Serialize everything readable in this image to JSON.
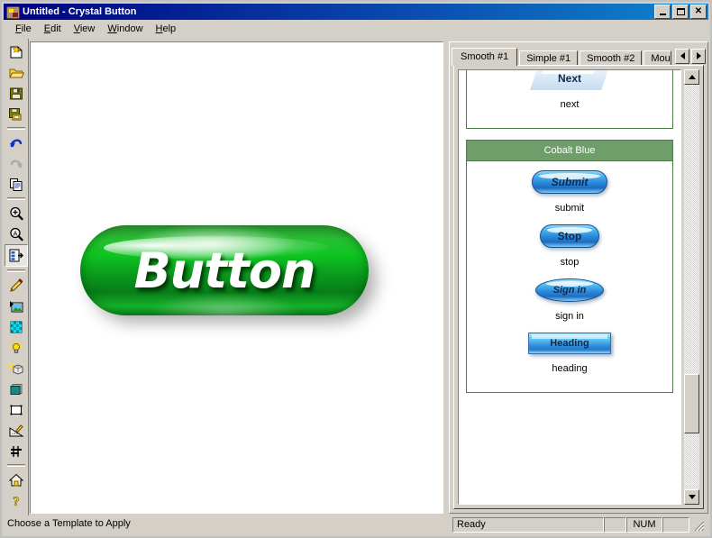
{
  "window": {
    "title": "Untitled - Crystal Button",
    "icon": "app-icon",
    "controls": {
      "minimize": "minimize",
      "maximize": "maximize",
      "close": "close"
    }
  },
  "menu": {
    "items": [
      {
        "label": "File",
        "accel": "F"
      },
      {
        "label": "Edit",
        "accel": "E"
      },
      {
        "label": "View",
        "accel": "V"
      },
      {
        "label": "Window",
        "accel": "W"
      },
      {
        "label": "Help",
        "accel": "H"
      }
    ]
  },
  "toolbar": {
    "tools": [
      {
        "name": "new-icon",
        "title": "New"
      },
      {
        "name": "open-folder-icon",
        "title": "Open"
      },
      {
        "name": "save-icon",
        "title": "Save"
      },
      {
        "name": "save-all-icon",
        "title": "Save All"
      },
      {
        "sep": true
      },
      {
        "name": "undo-icon",
        "title": "Undo"
      },
      {
        "name": "redo-icon",
        "title": "Redo",
        "disabled": true
      },
      {
        "name": "copy-icon",
        "title": "Copy"
      },
      {
        "sep": true
      },
      {
        "name": "zoom-in-icon",
        "title": "Zoom In"
      },
      {
        "name": "zoom-actual-icon",
        "title": "Actual Size"
      },
      {
        "name": "apply-template-icon",
        "title": "Apply Template",
        "pressed": true
      },
      {
        "sep": true
      },
      {
        "name": "text-pencil-icon",
        "title": "Text"
      },
      {
        "name": "image-icon",
        "title": "Image"
      },
      {
        "name": "texture-icon",
        "title": "Texture"
      },
      {
        "name": "light-bulb-icon",
        "title": "Light"
      },
      {
        "name": "light-effect-icon",
        "title": "Light Effect"
      },
      {
        "name": "color-fill-icon",
        "title": "Color"
      },
      {
        "name": "shape-icon",
        "title": "Shape"
      },
      {
        "name": "design-icon",
        "title": "Design"
      },
      {
        "name": "align-icon",
        "title": "Align"
      },
      {
        "sep": true
      },
      {
        "name": "home-icon",
        "title": "Home"
      },
      {
        "name": "help-icon",
        "title": "Help"
      }
    ]
  },
  "canvas": {
    "button": {
      "label": "Button",
      "color": "#0ec522",
      "shape": "rounded-pill"
    }
  },
  "templates_panel": {
    "tabs": [
      {
        "label": "Smooth #1",
        "active": true
      },
      {
        "label": "Simple #1",
        "active": false
      },
      {
        "label": "Smooth #2",
        "active": false
      },
      {
        "label": "Mouseove",
        "active": false,
        "truncated": true
      }
    ],
    "tab_scroll": {
      "left": "scroll-left",
      "right": "scroll-right"
    },
    "groups": [
      {
        "header": "",
        "items": [
          {
            "label": "Next",
            "caption": "next",
            "style": "slab"
          }
        ]
      },
      {
        "header": "Cobalt Blue",
        "items": [
          {
            "label": "Submit",
            "caption": "submit",
            "style": "pill-italic"
          },
          {
            "label": "Stop",
            "caption": "stop",
            "style": "pill"
          },
          {
            "label": "Sign in",
            "caption": "sign in",
            "style": "ellipse-italic"
          },
          {
            "label": "Heading",
            "caption": "heading",
            "style": "rect"
          }
        ]
      }
    ]
  },
  "statusbar": {
    "hint": "Choose a Template to Apply",
    "state": "Ready",
    "panel_blank_1": "",
    "num": "NUM",
    "panel_blank_2": ""
  },
  "colors": {
    "title_start": "#000080",
    "title_end": "#1084d0",
    "face": "#d4d0c8",
    "group_header": "#6f9e6b",
    "group_border": "#4f7a4a",
    "button_green": "#0ec522",
    "button_blue": "#2a86d8"
  }
}
